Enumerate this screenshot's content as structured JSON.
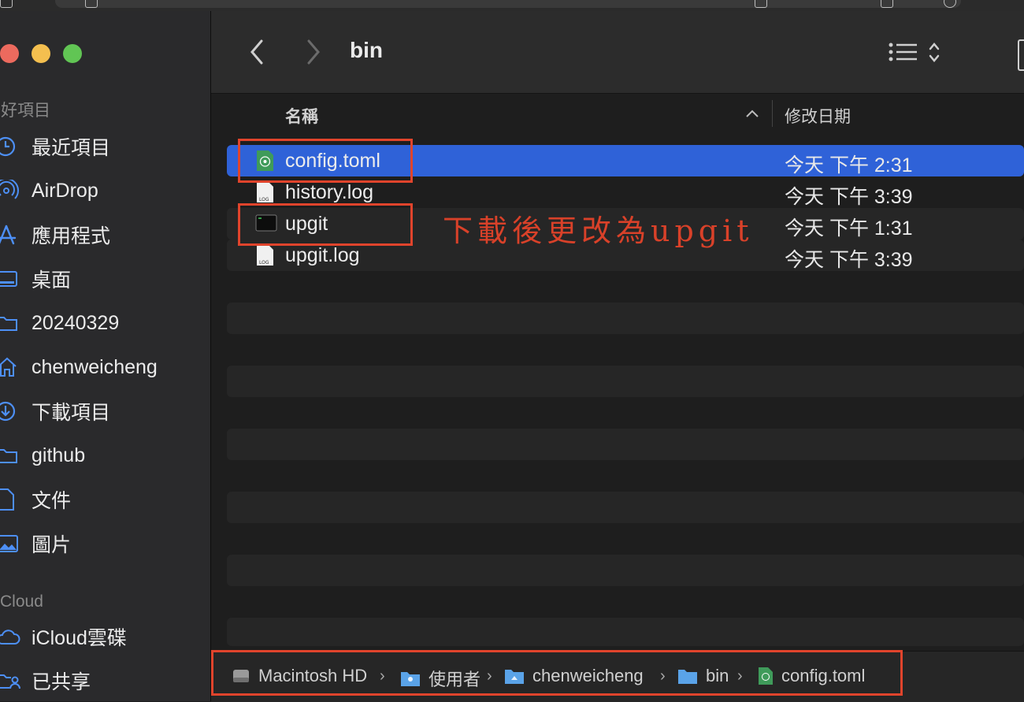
{
  "window": {
    "title": "bin"
  },
  "sidebar": {
    "favorites_title": "喜好項目",
    "cloud_title": "Cloud",
    "items": [
      {
        "label": "最近項目",
        "icon": "clock-icon"
      },
      {
        "label": "AirDrop",
        "icon": "airdrop-icon"
      },
      {
        "label": "應用程式",
        "icon": "applications-icon"
      },
      {
        "label": "桌面",
        "icon": "desktop-icon"
      },
      {
        "label": "20240329",
        "icon": "folder-icon"
      },
      {
        "label": "chenweicheng",
        "icon": "home-icon"
      },
      {
        "label": "下載項目",
        "icon": "download-icon"
      },
      {
        "label": "github",
        "icon": "folder-icon"
      },
      {
        "label": "文件",
        "icon": "document-icon"
      },
      {
        "label": "圖片",
        "icon": "photo-icon"
      }
    ],
    "cloud_items": [
      {
        "label": "iCloud雲碟",
        "icon": "cloud-icon"
      },
      {
        "label": "已共享",
        "icon": "shared-folder-icon"
      }
    ]
  },
  "columns": {
    "name": "名稱",
    "date": "修改日期"
  },
  "files": [
    {
      "name": "config.toml",
      "date": "今天 下午 2:31",
      "icon": "toml-file-icon",
      "selected": true
    },
    {
      "name": "history.log",
      "date": "今天 下午 3:39",
      "icon": "log-file-icon",
      "selected": false
    },
    {
      "name": "upgit",
      "date": "今天 下午 1:31",
      "icon": "executable-icon",
      "selected": false
    },
    {
      "name": "upgit.log",
      "date": "今天 下午 3:39",
      "icon": "log-file-icon",
      "selected": false
    }
  ],
  "annotation": {
    "text": "下載後更改為upgit",
    "color": "#d94129"
  },
  "pathbar": {
    "crumbs": [
      "Macintosh HD",
      "使用者",
      "chenweicheng",
      "bin",
      "config.toml"
    ]
  },
  "colors": {
    "selection": "#2f62d8",
    "annotation_box": "#e0442c"
  }
}
